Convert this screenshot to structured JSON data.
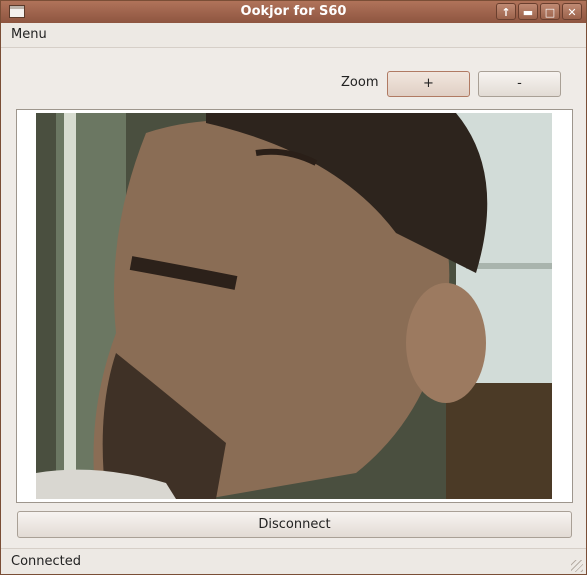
{
  "window": {
    "title": "Ookjor for S60",
    "buttons": [
      "up-arrow-icon",
      "minimize-icon",
      "maximize-icon",
      "close-icon"
    ]
  },
  "menubar": {
    "menu_label": "Menu"
  },
  "zoom": {
    "label": "Zoom",
    "in_label": "+",
    "out_label": "-"
  },
  "video": {
    "description_icon": "webcam-feed"
  },
  "actions": {
    "disconnect_label": "Disconnect"
  },
  "status": {
    "text": "Connected"
  },
  "colors": {
    "titlebar": "#9b624b",
    "window_bg": "#efebe7",
    "border": "#7a4e36"
  }
}
